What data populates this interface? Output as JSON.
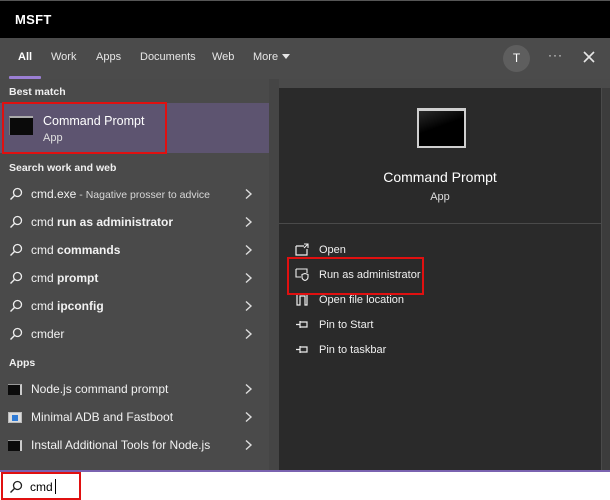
{
  "window": {
    "title": "MSFT"
  },
  "tabs": [
    {
      "label": "All",
      "active": true
    },
    {
      "label": "Work"
    },
    {
      "label": "Apps"
    },
    {
      "label": "Documents"
    },
    {
      "label": "Web"
    },
    {
      "label": "More"
    }
  ],
  "header_actions": {
    "avatar_initial": "T",
    "more_options": "···",
    "close": "close-icon"
  },
  "colors": {
    "accent": "#9b7fd4",
    "selected_bg": "#5d5470",
    "highlight_border": "#e01010",
    "preview_bg": "#2a2a2a"
  },
  "best_match": {
    "label": "Best match",
    "title": "Command Prompt",
    "subtitle": "App",
    "icon": "terminal-icon"
  },
  "search_web": {
    "label": "Search work and web",
    "items": [
      {
        "prefix": "cmd.exe",
        "bold": "",
        "desc": " - Nagative prosser to advice"
      },
      {
        "prefix": "cmd ",
        "bold": "run as administrator",
        "desc": ""
      },
      {
        "prefix": "cmd ",
        "bold": "commands",
        "desc": ""
      },
      {
        "prefix": "cmd ",
        "bold": "prompt",
        "desc": ""
      },
      {
        "prefix": "cmd ",
        "bold": "ipconfig",
        "desc": ""
      },
      {
        "prefix": "cmder",
        "bold": "",
        "desc": ""
      }
    ]
  },
  "apps": {
    "label": "Apps",
    "items": [
      {
        "label": "Node.js command prompt",
        "icon": "terminal-icon"
      },
      {
        "label": "Minimal ADB and Fastboot",
        "icon": "adb-icon"
      },
      {
        "label": "Install Additional Tools for Node.js",
        "icon": "terminal-icon"
      }
    ]
  },
  "preview": {
    "title": "Command Prompt",
    "subtitle": "App",
    "actions": [
      {
        "label": "Open",
        "icon": "open-icon"
      },
      {
        "label": "Run as administrator",
        "icon": "shield-icon"
      },
      {
        "label": "Open file location",
        "icon": "folder-icon"
      },
      {
        "label": "Pin to Start",
        "icon": "pin-icon"
      },
      {
        "label": "Pin to taskbar",
        "icon": "pin-icon"
      }
    ]
  },
  "search": {
    "value": "cmd",
    "placeholder": ""
  }
}
